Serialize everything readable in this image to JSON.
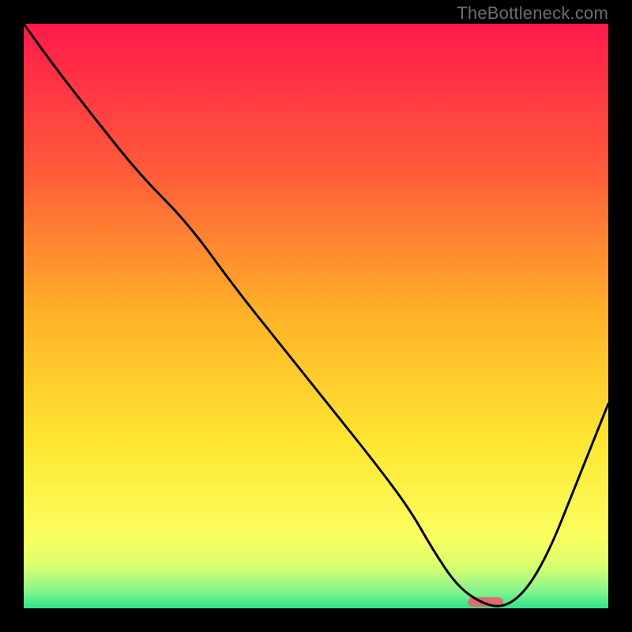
{
  "watermark": "TheBottleneck.com",
  "chart_data": {
    "type": "line",
    "title": "",
    "xlabel": "",
    "ylabel": "",
    "xlim": [
      0,
      100
    ],
    "ylim": [
      0,
      100
    ],
    "grid": false,
    "legend": false,
    "axes_visible": false,
    "background_gradient": {
      "stops": [
        {
          "pos": 0.0,
          "color": "#ff1a4b"
        },
        {
          "pos": 0.25,
          "color": "#ff5a3a"
        },
        {
          "pos": 0.5,
          "color": "#ffb327"
        },
        {
          "pos": 0.72,
          "color": "#ffe733"
        },
        {
          "pos": 0.88,
          "color": "#faff60"
        },
        {
          "pos": 0.93,
          "color": "#d7ff70"
        },
        {
          "pos": 0.97,
          "color": "#86f58c"
        },
        {
          "pos": 1.0,
          "color": "#2fe48a"
        }
      ]
    },
    "curve": {
      "x": [
        0,
        5,
        12,
        20,
        28,
        36,
        44,
        52,
        60,
        66,
        70,
        74,
        78,
        82,
        86,
        90,
        94,
        98,
        100
      ],
      "y": [
        100,
        93,
        84,
        74,
        66,
        55,
        45,
        35,
        25,
        17,
        10,
        4,
        1,
        0,
        3,
        10,
        20,
        30,
        35
      ]
    },
    "optimal_marker": {
      "x_center": 79,
      "width": 6,
      "color": "#e06a6e"
    }
  }
}
